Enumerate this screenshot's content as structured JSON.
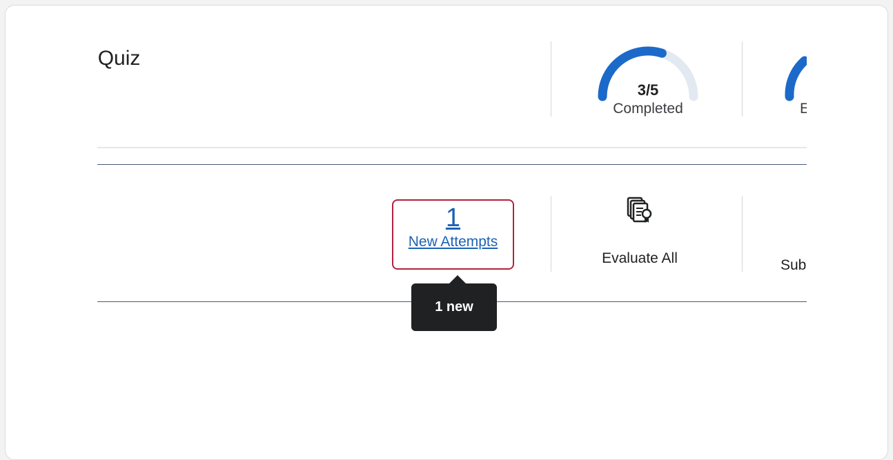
{
  "quiz": {
    "title_fragment": "Quiz"
  },
  "gauges": [
    {
      "value_text": "3/5",
      "label": "Completed",
      "fraction": 0.6,
      "color": "#1b6ac9",
      "track": "#e3e9f1"
    },
    {
      "label_fragment": "E",
      "color": "#1b6ac9"
    }
  ],
  "attempts": {
    "count": "1",
    "label": "New Attempts",
    "border_color": "#b0223d",
    "link_color": "#1b62b5"
  },
  "tooltip": {
    "text": "1 new"
  },
  "actions": {
    "evaluate_all": "Evaluate All",
    "submissions_fragment": "Sub",
    "evaluate_icon": "documents-ribbon-icon"
  }
}
